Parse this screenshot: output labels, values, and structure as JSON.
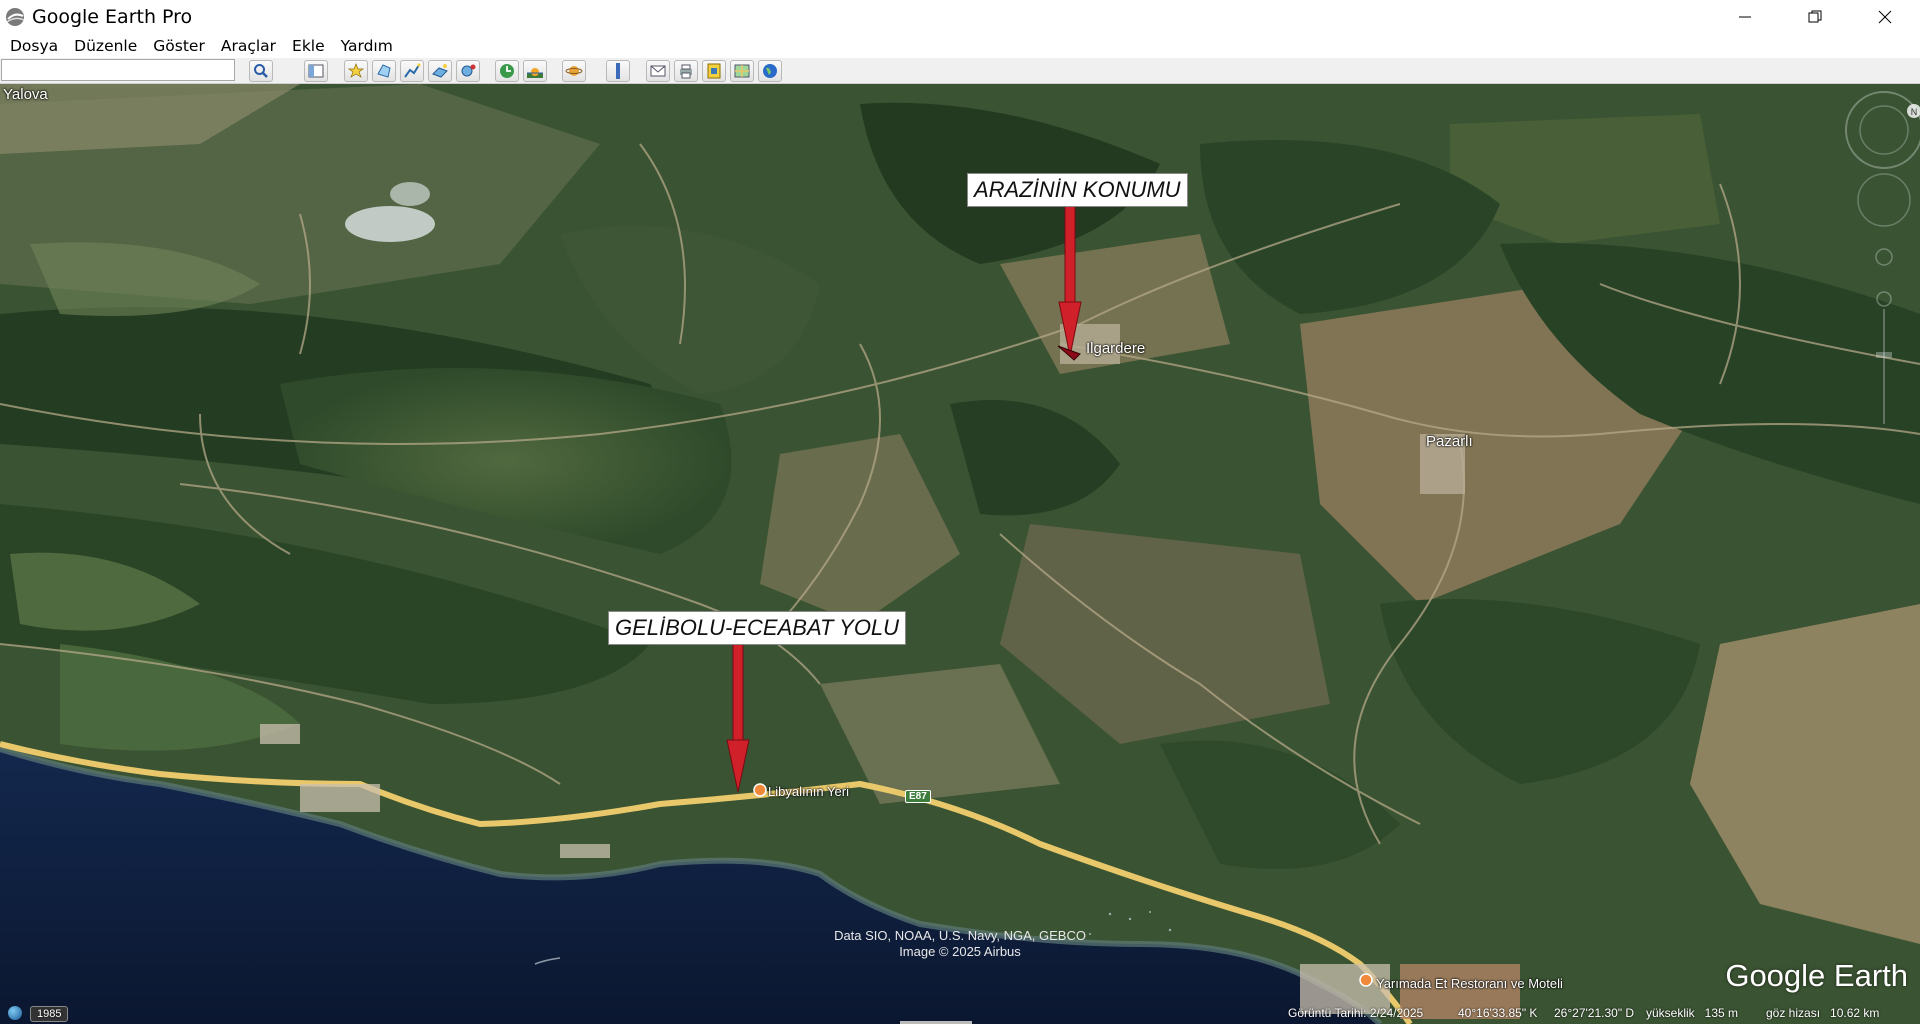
{
  "window": {
    "title": "Google Earth Pro"
  },
  "menu": [
    "Dosya",
    "Düzenle",
    "Göster",
    "Araçlar",
    "Ekle",
    "Yardım"
  ],
  "search": {
    "value": ""
  },
  "toolbar_icons": [
    "search-icon",
    "sidebar-icon",
    "placemark-icon",
    "polygon-icon",
    "path-icon",
    "image-overlay-icon",
    "record-tour-icon",
    "historical-imagery-icon",
    "sunlight-icon",
    "planets-icon",
    "ruler-icon",
    "email-icon",
    "print-icon",
    "save-image-icon",
    "maps-icon",
    "globe-icon"
  ],
  "map": {
    "annotations": {
      "arazi": "ARAZİNİN KONUMU",
      "yol": "GELİBOLU-ECEABAT YOLU"
    },
    "places": {
      "yalova": "Yalova",
      "ilgardere": "Ilgardere",
      "pazarli": "Pazarlı",
      "libyali": "Libyalının Yeri",
      "yarimada": "Yarımada Et Restoranı ve Moteli"
    },
    "road_shield": "E87",
    "attribution": {
      "line1": "Data SIO, NOAA, U.S. Navy, NGA, GEBCO",
      "line2": "Image © 2025 Airbus"
    },
    "logo": "Google Earth"
  },
  "status": {
    "year": "1985",
    "imagery_date": "Görüntü Tarihi: 2/24/2025",
    "lat": "40°16'33.85\" K",
    "lon": "26°27'21.30\" D",
    "elevation": "yükseklik   135 m",
    "eye_alt": "göz hizası   10.62 km"
  },
  "colors": {
    "sea": "#0f1f3f",
    "forest": "#2c4a2a",
    "road": "#e8c86a",
    "marker": "#d0202a"
  }
}
